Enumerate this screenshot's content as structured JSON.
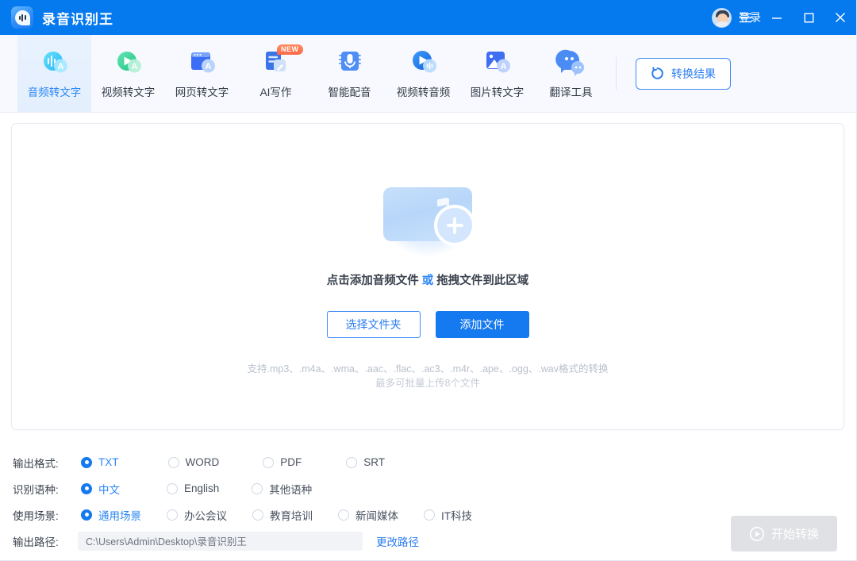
{
  "titlebar": {
    "app_title": "录音识别王",
    "logo_icon": "app-logo-icon",
    "login_label": "登录",
    "avatar_icon": "user-avatar-icon",
    "menu_icon": "hamburger-menu-icon",
    "minimize_icon": "minimize-icon",
    "maximize_icon": "maximize-icon",
    "close_icon": "close-icon",
    "bg_color": "#0579ee"
  },
  "toolbar": {
    "tools": [
      {
        "label": "音频转文字",
        "icon": "audio-to-text-icon",
        "active": true,
        "badge": ""
      },
      {
        "label": "视频转文字",
        "icon": "video-to-text-icon",
        "active": false,
        "badge": ""
      },
      {
        "label": "网页转文字",
        "icon": "webpage-to-text-icon",
        "active": false,
        "badge": ""
      },
      {
        "label": "AI写作",
        "icon": "ai-writing-icon",
        "active": false,
        "badge": "NEW"
      },
      {
        "label": "智能配音",
        "icon": "smart-dubbing-icon",
        "active": false,
        "badge": ""
      },
      {
        "label": "视频转音频",
        "icon": "video-to-audio-icon",
        "active": false,
        "badge": ""
      },
      {
        "label": "图片转文字",
        "icon": "image-to-text-icon",
        "active": false,
        "badge": ""
      },
      {
        "label": "翻译工具",
        "icon": "translation-tool-icon",
        "active": false,
        "badge": ""
      }
    ],
    "result_button": {
      "label": "转换结果",
      "icon": "refresh-circle-icon"
    }
  },
  "dropzone": {
    "icon": "audio-file-add-icon",
    "prompt_a": "点击添加音频文件",
    "prompt_or": "或",
    "prompt_b": "拖拽文件到此区域",
    "choose_folder_label": "选择文件夹",
    "add_file_label": "添加文件",
    "support_line1": "支持.mp3、.m4a、.wma、.aac、.flac、.ac3、.m4r、.ape、.ogg、.wav格式的转换",
    "support_line2": "最多可批量上传8个文件"
  },
  "settings": {
    "rows": [
      {
        "label": "输出格式:",
        "options": [
          {
            "label": "TXT",
            "selected": true
          },
          {
            "label": "WORD",
            "selected": false
          },
          {
            "label": "PDF",
            "selected": false
          },
          {
            "label": "SRT",
            "selected": false
          }
        ],
        "gaps": [
          96,
          105,
          88
        ]
      },
      {
        "label": "识别语种:",
        "options": [
          {
            "label": "中文",
            "selected": true
          },
          {
            "label": "English",
            "selected": false
          },
          {
            "label": "其他语种",
            "selected": false
          }
        ],
        "gaps": [
          96,
          105
        ]
      },
      {
        "label": "使用场景:",
        "options": [
          {
            "label": "通用场景",
            "selected": true
          },
          {
            "label": "办公会议",
            "selected": false
          },
          {
            "label": "教育培训",
            "selected": false
          },
          {
            "label": "新闻媒体",
            "selected": false
          },
          {
            "label": "IT科技",
            "selected": false
          }
        ],
        "gaps": [
          63,
          58,
          58,
          58
        ]
      }
    ],
    "path_row": {
      "label": "输出路径:",
      "value": "C:\\Users\\Admin\\Desktop\\录音识别王",
      "placeholder": "C:\\Users\\Admin\\Desktop\\录音识别王",
      "change_link": "更改路径"
    },
    "start_button": {
      "label": "开始转换",
      "icon": "play-circle-icon",
      "disabled": true
    }
  },
  "colors": {
    "brand_blue": "#1579f0",
    "header_blue": "#0579ee",
    "link_blue": "#2b7df2",
    "toolbar_bg": "#f7f9fe",
    "disabled_gray": "#e0e1e4"
  }
}
